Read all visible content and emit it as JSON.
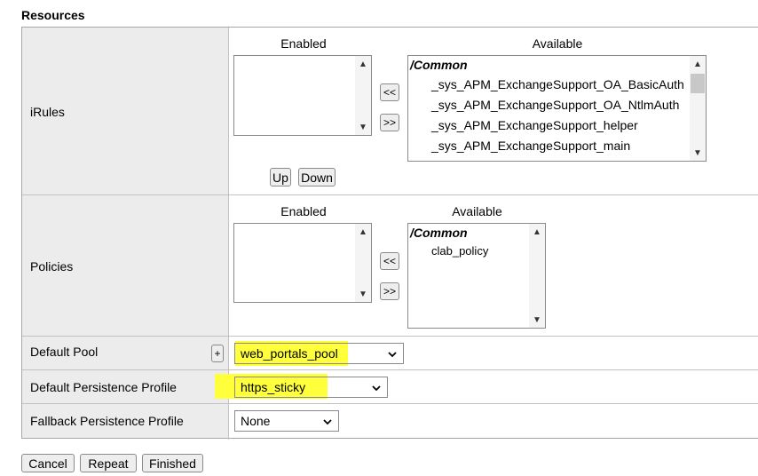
{
  "section": {
    "title": "Resources"
  },
  "colors": {
    "highlight": "#ffff3b",
    "label_bg": "#ececec",
    "border": "#a6a6a6"
  },
  "irules": {
    "label": "iRules",
    "enabled_header": "Enabled",
    "available_header": "Available",
    "available_group": "/Common",
    "available_items": [
      "_sys_APM_ExchangeSupport_OA_BasicAuth",
      "_sys_APM_ExchangeSupport_OA_NtlmAuth",
      "_sys_APM_ExchangeSupport_helper",
      "_sys_APM_ExchangeSupport_main"
    ],
    "move_left": "<<",
    "move_right": ">>",
    "up": "Up",
    "down": "Down"
  },
  "policies": {
    "label": "Policies",
    "enabled_header": "Enabled",
    "available_header": "Available",
    "available_group": "/Common",
    "available_items": [
      "clab_policy"
    ],
    "move_left": "<<",
    "move_right": ">>"
  },
  "default_pool": {
    "label": "Default Pool",
    "add": "+",
    "value": "web_portals_pool"
  },
  "default_persistence": {
    "label": "Default Persistence Profile",
    "value": "https_sticky"
  },
  "fallback_persistence": {
    "label": "Fallback Persistence Profile",
    "value": "None"
  },
  "actions": {
    "cancel": "Cancel",
    "repeat": "Repeat",
    "finished": "Finished"
  }
}
